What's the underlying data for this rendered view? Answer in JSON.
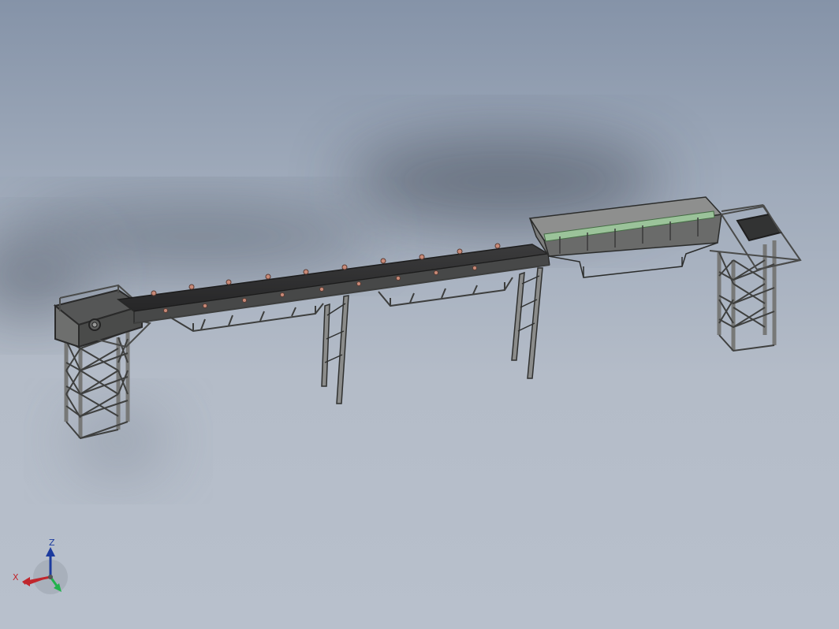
{
  "app": {
    "view": "3d-model-viewport"
  },
  "model": {
    "name": "belt-conveyor-assembly",
    "components": [
      "left-tower",
      "conveyor-belt",
      "mid-supports",
      "hopper",
      "right-tower"
    ],
    "colors": {
      "background_top": "#8593a8",
      "background_bottom": "#b8c0cc",
      "belt": "#2f2f30",
      "frame": "#6b6c6b",
      "hopper_accent": "#9bc39a",
      "idler_bolt": "#c98a78"
    }
  },
  "triad": {
    "x_label": "X",
    "z_label": "Z",
    "x_color": "#c0262d",
    "y_color": "#22b24c",
    "z_color": "#1c3b9e"
  }
}
